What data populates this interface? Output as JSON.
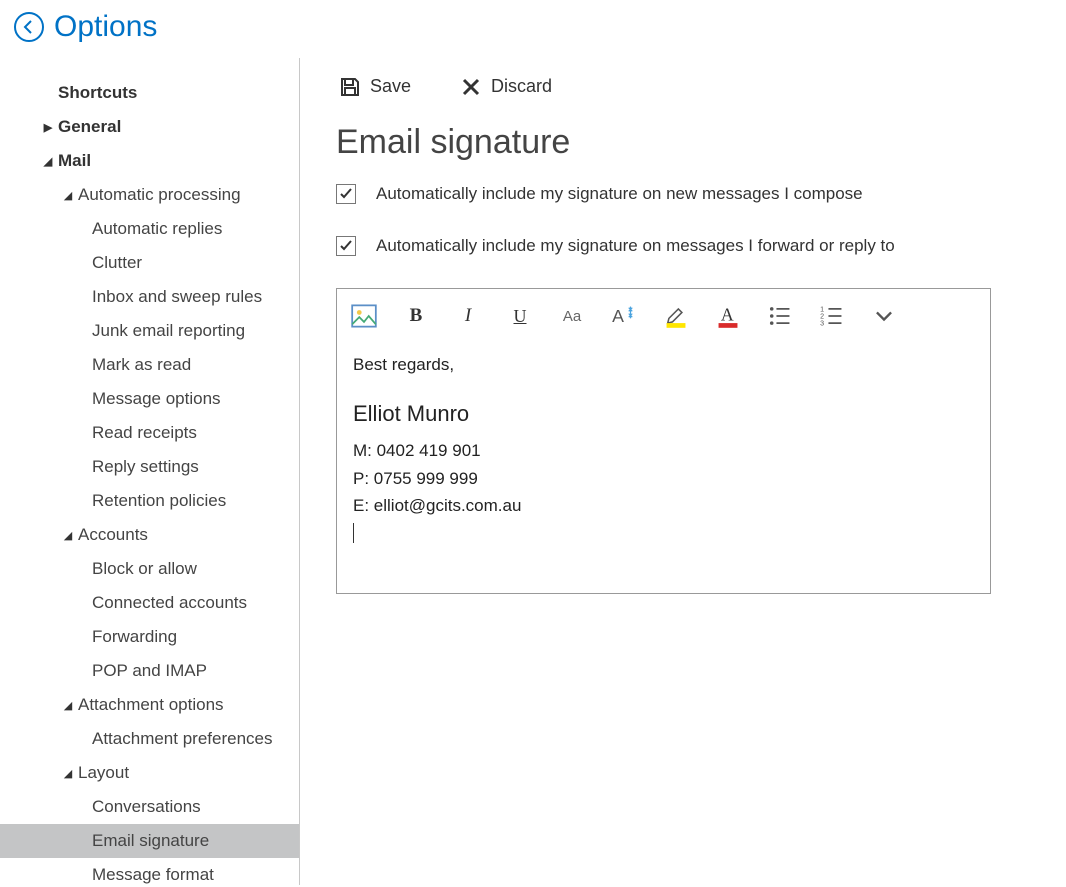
{
  "header": {
    "title": "Options"
  },
  "toolbar": {
    "save_label": "Save",
    "discard_label": "Discard"
  },
  "page": {
    "title": "Email signature"
  },
  "options": {
    "include_new": "Automatically include my signature on new messages I compose",
    "include_reply": "Automatically include my signature on messages I forward or reply to"
  },
  "signature": {
    "greeting": "Best regards,",
    "name": "Elliot Munro",
    "mobile": "M: 0402 419 901",
    "phone": "P: 0755 999 999",
    "email": "E: elliot@gcits.com.au"
  },
  "nav": {
    "shortcuts": "Shortcuts",
    "general": "General",
    "mail": "Mail",
    "automatic_processing": "Automatic processing",
    "automatic_replies": "Automatic replies",
    "clutter": "Clutter",
    "inbox_sweep": "Inbox and sweep rules",
    "junk_email": "Junk email reporting",
    "mark_as_read": "Mark as read",
    "message_options": "Message options",
    "read_receipts": "Read receipts",
    "reply_settings": "Reply settings",
    "retention_policies": "Retention policies",
    "accounts": "Accounts",
    "block_or_allow": "Block or allow",
    "connected_accounts": "Connected accounts",
    "forwarding": "Forwarding",
    "pop_imap": "POP and IMAP",
    "attachment_options": "Attachment options",
    "attachment_preferences": "Attachment preferences",
    "layout": "Layout",
    "conversations": "Conversations",
    "email_signature": "Email signature",
    "message_format": "Message format"
  }
}
